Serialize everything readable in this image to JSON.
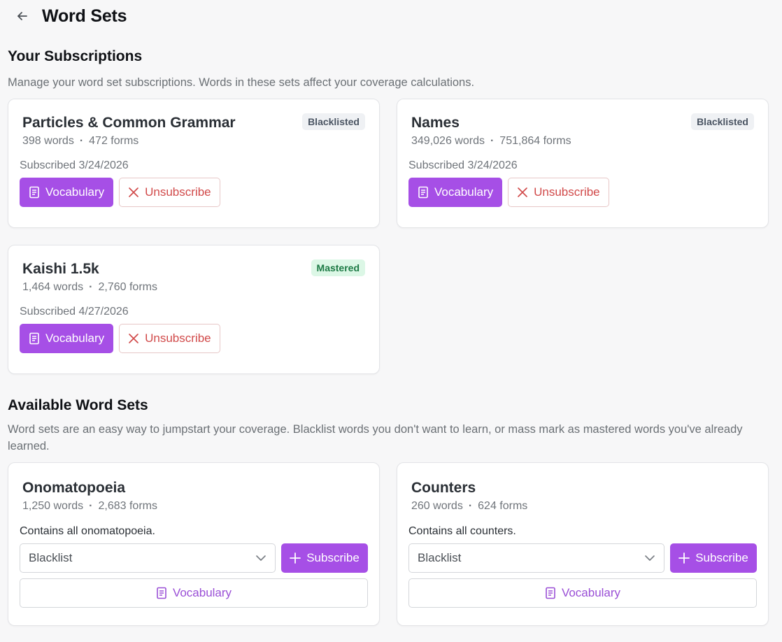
{
  "header": {
    "title": "Word Sets"
  },
  "subscriptions": {
    "title": "Your Subscriptions",
    "description": "Manage your word set subscriptions. Words in these sets affect your coverage calculations.",
    "vocab_label": "Vocabulary",
    "unsubscribe_label": "Unsubscribe",
    "items": [
      {
        "name": "Particles & Common Grammar",
        "words": "398 words",
        "forms": "472 forms",
        "subscribed": "Subscribed 3/24/2026",
        "badge": "Blacklisted"
      },
      {
        "name": "Names",
        "words": "349,026 words",
        "forms": "751,864 forms",
        "subscribed": "Subscribed 3/24/2026",
        "badge": "Blacklisted"
      },
      {
        "name": "Kaishi 1.5k",
        "words": "1,464 words",
        "forms": "2,760 forms",
        "subscribed": "Subscribed 4/27/2026",
        "badge": "Mastered"
      }
    ]
  },
  "available": {
    "title": "Available Word Sets",
    "description": "Word sets are an easy way to jumpstart your coverage. Blacklist words you don't want to learn, or mass mark as mastered words you've already learned.",
    "subscribe_label": "Subscribe",
    "vocab_label": "Vocabulary",
    "items": [
      {
        "name": "Onomatopoeia",
        "words": "1,250 words",
        "forms": "2,683 forms",
        "desc": "Contains all onomatopoeia.",
        "select_value": "Blacklist"
      },
      {
        "name": "Counters",
        "words": "260 words",
        "forms": "624 forms",
        "desc": "Contains all counters.",
        "select_value": "Blacklist"
      }
    ]
  },
  "colors": {
    "accent": "#a64fe6",
    "danger": "#d14a4a",
    "mastered_bg": "#dcf7e6",
    "blacklisted_bg": "#eff1f4"
  }
}
